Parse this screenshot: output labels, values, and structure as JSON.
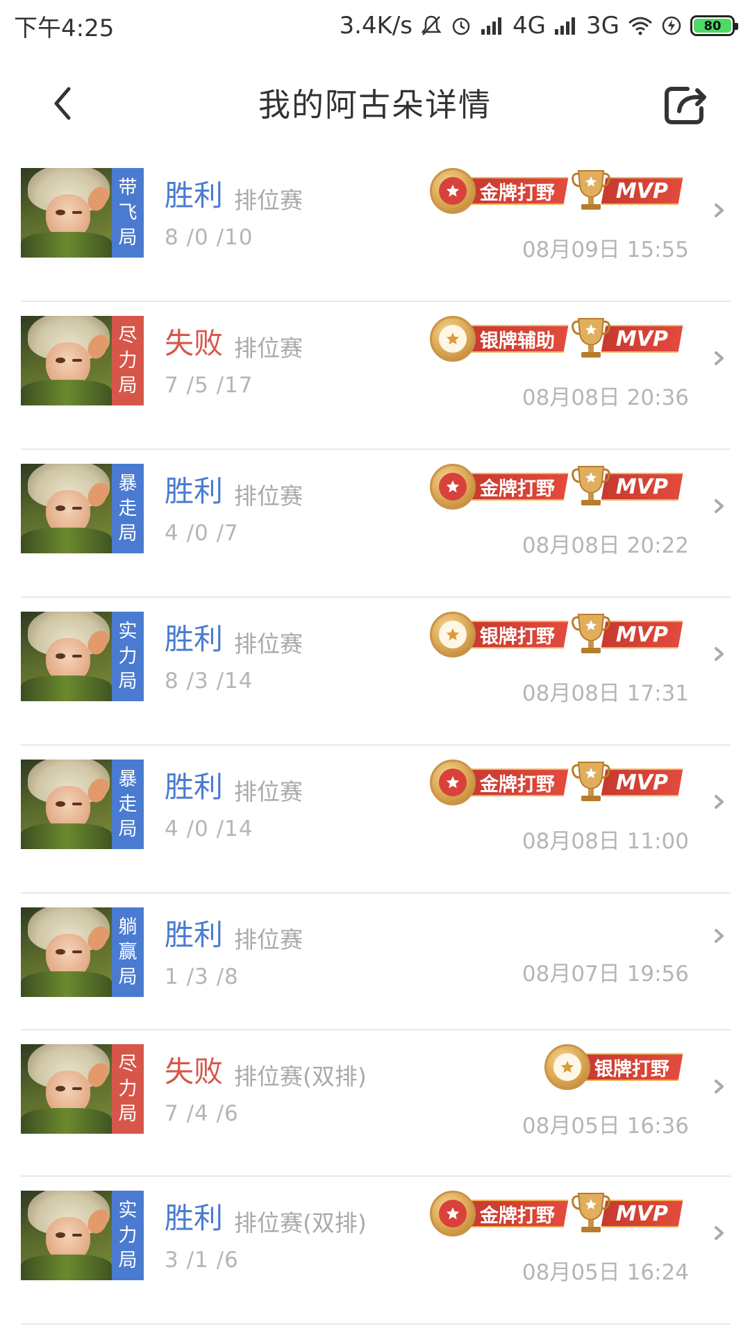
{
  "status_bar": {
    "time": "下午4:25",
    "net_speed": "3.4K/s",
    "net1": "4G",
    "net2": "3G",
    "battery": "80"
  },
  "header": {
    "title": "我的阿古朵详情"
  },
  "matches": [
    {
      "tag": [
        "带",
        "飞",
        "局"
      ],
      "tag_color": "blue",
      "result": "胜利",
      "result_type": "win",
      "mode": "排位赛",
      "kda": "8 /0 /10",
      "time": "08月09日 15:55",
      "medal": {
        "label": "金牌打野",
        "tier": "gold"
      },
      "mvp": "MVP"
    },
    {
      "tag": [
        "尽",
        "力",
        "局"
      ],
      "tag_color": "red",
      "result": "失败",
      "result_type": "lose",
      "mode": "排位赛",
      "kda": "7 /5 /17",
      "time": "08月08日 20:36",
      "medal": {
        "label": "银牌辅助",
        "tier": "silver"
      },
      "mvp": "MVP"
    },
    {
      "tag": [
        "暴",
        "走",
        "局"
      ],
      "tag_color": "blue",
      "result": "胜利",
      "result_type": "win",
      "mode": "排位赛",
      "kda": "4 /0 /7",
      "time": "08月08日 20:22",
      "medal": {
        "label": "金牌打野",
        "tier": "gold"
      },
      "mvp": "MVP"
    },
    {
      "tag": [
        "实",
        "力",
        "局"
      ],
      "tag_color": "blue",
      "result": "胜利",
      "result_type": "win",
      "mode": "排位赛",
      "kda": "8 /3 /14",
      "time": "08月08日 17:31",
      "medal": {
        "label": "银牌打野",
        "tier": "silver"
      },
      "mvp": "MVP"
    },
    {
      "tag": [
        "暴",
        "走",
        "局"
      ],
      "tag_color": "blue",
      "result": "胜利",
      "result_type": "win",
      "mode": "排位赛",
      "kda": "4 /0 /14",
      "time": "08月08日 11:00",
      "medal": {
        "label": "金牌打野",
        "tier": "gold"
      },
      "mvp": "MVP"
    },
    {
      "tag": [
        "躺",
        "赢",
        "局"
      ],
      "tag_color": "blue",
      "result": "胜利",
      "result_type": "win",
      "mode": "排位赛",
      "kda": "1 /3 /8",
      "time": "08月07日 19:56",
      "medal": null,
      "mvp": null
    },
    {
      "tag": [
        "尽",
        "力",
        "局"
      ],
      "tag_color": "red",
      "result": "失败",
      "result_type": "lose",
      "mode": "排位赛(双排)",
      "kda": "7 /4 /6",
      "time": "08月05日 16:36",
      "medal": {
        "label": "银牌打野",
        "tier": "silver"
      },
      "mvp": null
    },
    {
      "tag": [
        "实",
        "力",
        "局"
      ],
      "tag_color": "blue",
      "result": "胜利",
      "result_type": "win",
      "mode": "排位赛(双排)",
      "kda": "3 /1 /6",
      "time": "08月05日 16:24",
      "medal": {
        "label": "金牌打野",
        "tier": "gold"
      },
      "mvp": "MVP"
    }
  ],
  "icons": {
    "back": "chevron-left-icon",
    "share": "share-icon",
    "row_arrow": "chevron-right-icon",
    "medal": "medal-icon",
    "trophy": "trophy-icon"
  },
  "colors": {
    "win": "#4a7bd0",
    "lose": "#d6574a",
    "ribbon": "#d8423a",
    "medal_gold": "#e0ae5c"
  }
}
